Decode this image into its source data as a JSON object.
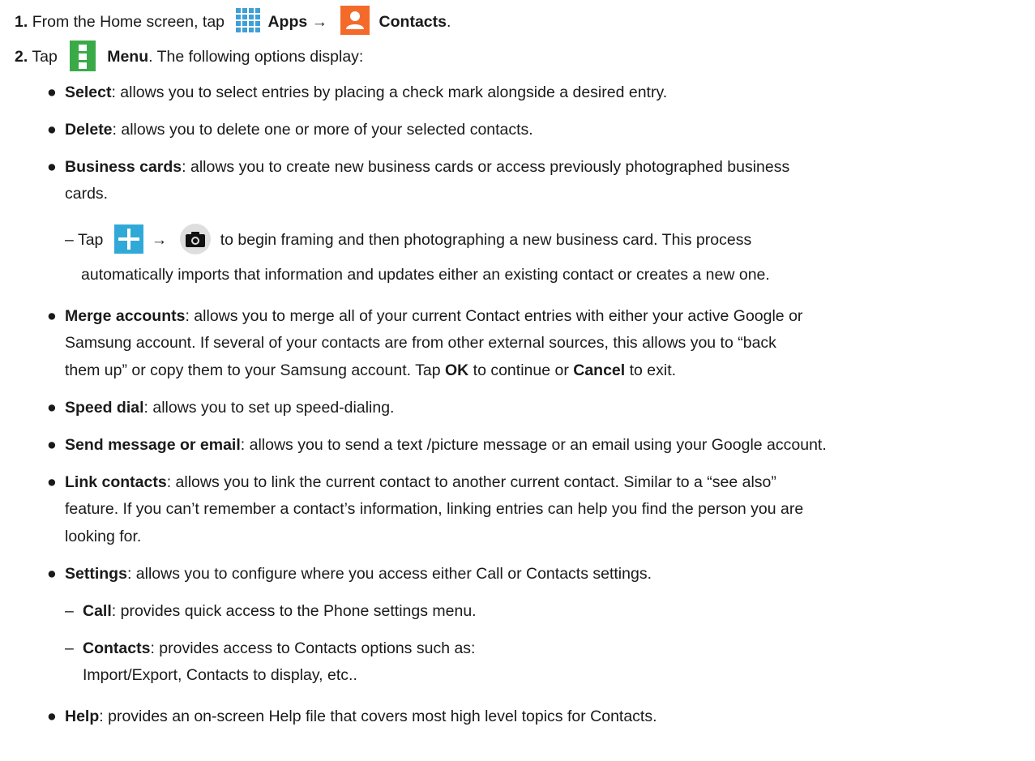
{
  "step1": {
    "number": "1.",
    "prefix": "From the Home screen, tap",
    "apps_label": "Apps",
    "arrow": "→",
    "contacts_label": "Contacts",
    "end": "."
  },
  "step2": {
    "number": "2.",
    "prefix": "Tap",
    "menu_label": "Menu",
    "rest": ". The following options display:"
  },
  "options": {
    "select": {
      "label": "Select",
      "desc": ": allows you to select entries by placing a check mark alongside a desired entry."
    },
    "delete": {
      "label": "Delete",
      "desc": ": allows you to delete one or more of your selected contacts."
    },
    "business_cards": {
      "label": "Business cards",
      "desc_line1": ": allows you to create new business cards or access previously photographed business",
      "desc_line2": "cards.",
      "sub": {
        "prefix": "Tap",
        "arrow": "→",
        "line1": "to begin framing and then photographing a new business card. This process",
        "line2": "automatically imports that information and updates either an existing contact or creates a new one."
      }
    },
    "merge_accounts": {
      "label": "Merge accounts",
      "desc_line1": ": allows you to merge all of your current Contact entries with either your active Google or",
      "line2": "Samsung account. If several of your contacts are from other external sources, this allows you to “back",
      "line3_prefix": "them up” or copy them to your Samsung account. Tap",
      "ok": "OK",
      "line3_mid": "to continue or",
      "cancel": "Cancel",
      "line3_end": "to exit."
    },
    "speed_dial": {
      "label": "Speed dial",
      "desc": ": allows you to set up speed-dialing."
    },
    "send_message": {
      "label": "Send message or email",
      "desc": ": allows you to send a text /picture message or an email using your Google account."
    },
    "link_contacts": {
      "label": "Link contacts",
      "desc_line1": ": allows you to link the current contact to another current contact. Similar to a “see also”",
      "line2": "feature. If you can’t remember a contact’s information, linking entries can help you find the person you are",
      "line3": "looking for."
    },
    "settings": {
      "label": "Settings",
      "desc": ": allows you to configure where you access either Call or Contacts settings.",
      "call": {
        "label": "Call",
        "desc": ": provides quick access to the Phone settings menu."
      },
      "contacts": {
        "label": "Contacts",
        "desc": ": provides access to Contacts options such as:",
        "line2": "Import/Export, Contacts to display, etc.."
      }
    },
    "help": {
      "label": "Help",
      "desc": ": provides an on-screen Help file that covers most high level topics for Contacts."
    }
  },
  "symbols": {
    "bullet": "●",
    "dash": "–"
  },
  "colors": {
    "contacts_icon": "#f46a2a",
    "menu_icon": "#3aaa48",
    "plus_icon": "#31a9d8",
    "apps_icon": "#3f9fd6",
    "camera_bg": "#dedede"
  },
  "icons": [
    "apps-grid-icon",
    "contacts-person-icon",
    "menu-icon",
    "plus-icon",
    "camera-icon"
  ]
}
